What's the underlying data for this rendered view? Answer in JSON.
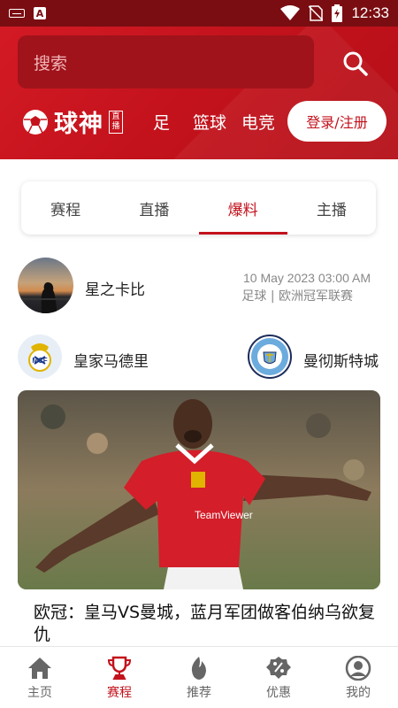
{
  "status_bar": {
    "time": "12:33",
    "icons": [
      "keyboard-icon",
      "a-icon",
      "wifi-icon",
      "no-sim-icon",
      "battery-icon"
    ]
  },
  "header": {
    "search_placeholder": "搜索",
    "logo_text": "球神",
    "logo_badge": "直播",
    "categories": [
      "足",
      "篮球",
      "电竞"
    ],
    "login_label": "登录/注册"
  },
  "tabs": {
    "items": [
      "赛程",
      "直播",
      "爆料",
      "主播"
    ],
    "active_index": 2
  },
  "post": {
    "author": "星之卡比",
    "date": "10 May 2023 03:00 AM",
    "league": "足球 | 欧洲冠军联赛",
    "home_team": "皇家马德里",
    "away_team": "曼彻斯特城",
    "title": "欧冠：皇马VS曼城，蓝月军团做客伯纳乌欲复仇"
  },
  "bottom_nav": {
    "items": [
      "主页",
      "赛程",
      "推荐",
      "优惠",
      "我的"
    ],
    "active_index": 1
  },
  "colors": {
    "brand_red": "#c3121c",
    "status_bar": "#7a0d12"
  }
}
